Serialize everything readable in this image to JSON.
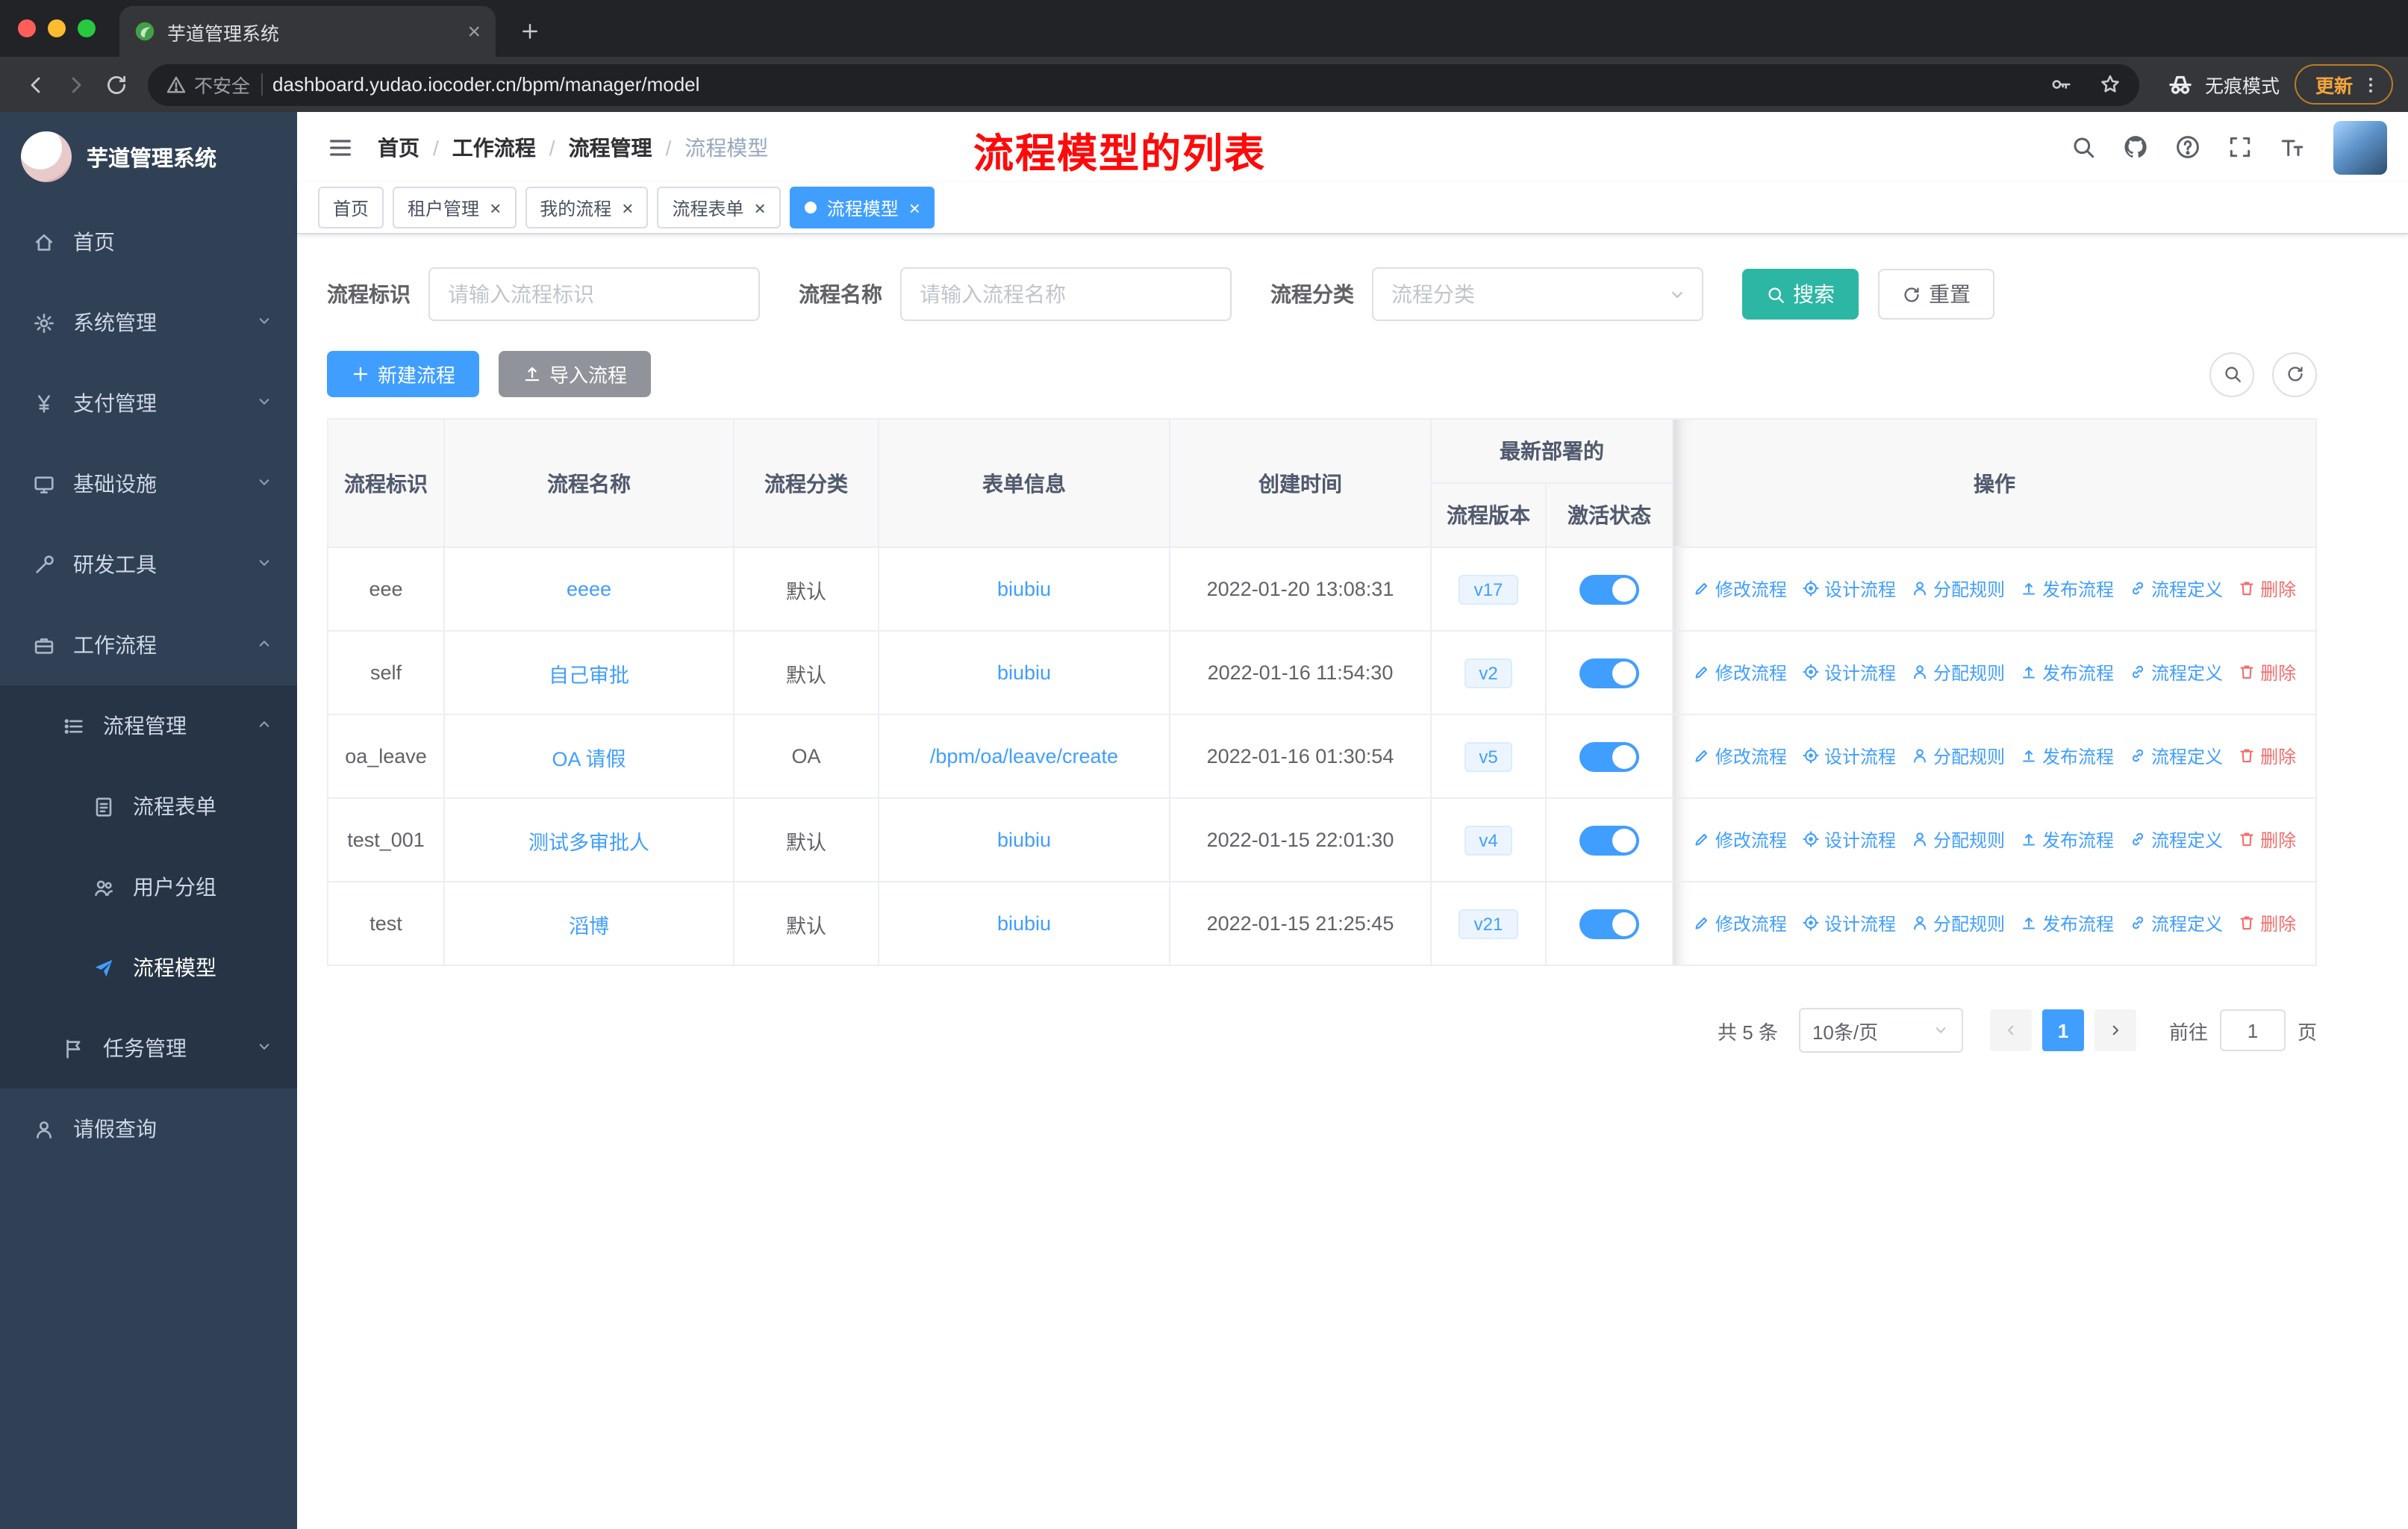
{
  "colors": {
    "primary": "#409eff",
    "search_button": "#2bb7a3",
    "danger": "#f56c6c",
    "annotation": "#fd0b0b",
    "sidebar_bg": "#304156",
    "sidebar_submenu_bg": "#263445",
    "update_pill": "#f1a33c"
  },
  "browser": {
    "tab_title": "芋道管理系统",
    "security_label": "不安全",
    "url": "dashboard.yudao.iocoder.cn/bpm/manager/model",
    "incognito_label": "无痕模式",
    "update_label": "更新"
  },
  "sidebar": {
    "logo_title": "芋道管理系统",
    "items": [
      {
        "id": "home",
        "label": "首页",
        "icon": "home-icon",
        "depth": 0
      },
      {
        "id": "system",
        "label": "系统管理",
        "icon": "gear-icon",
        "depth": 0,
        "arrow": "down"
      },
      {
        "id": "payment",
        "label": "支付管理",
        "icon": "yen-icon",
        "depth": 0,
        "arrow": "down"
      },
      {
        "id": "infra",
        "label": "基础设施",
        "icon": "monitor-icon",
        "depth": 0,
        "arrow": "down"
      },
      {
        "id": "devtools",
        "label": "研发工具",
        "icon": "wrench-icon",
        "depth": 0,
        "arrow": "down"
      },
      {
        "id": "workflow",
        "label": "工作流程",
        "icon": "briefcase-icon",
        "depth": 0,
        "arrow": "up"
      },
      {
        "id": "process-mgmt",
        "label": "流程管理",
        "icon": "list-icon",
        "depth": 1,
        "arrow": "up",
        "sub": true
      },
      {
        "id": "process-form",
        "label": "流程表单",
        "icon": "document-icon",
        "depth": 2,
        "sub": true
      },
      {
        "id": "user-group",
        "label": "用户分组",
        "icon": "users-icon",
        "depth": 2,
        "sub": true
      },
      {
        "id": "process-model",
        "label": "流程模型",
        "icon": "send-icon",
        "depth": 2,
        "sub": true,
        "active": true
      },
      {
        "id": "task-mgmt",
        "label": "任务管理",
        "icon": "flag-icon",
        "depth": 1,
        "arrow": "down",
        "sub": true
      },
      {
        "id": "leave-query",
        "label": "请假查询",
        "icon": "user-icon",
        "depth": 0
      }
    ]
  },
  "header": {
    "breadcrumb": [
      "首页",
      "工作流程",
      "流程管理",
      "流程模型"
    ],
    "annotation": "流程模型的列表"
  },
  "tabs": [
    {
      "id": "home",
      "label": "首页",
      "closable": false,
      "active": false
    },
    {
      "id": "tenant",
      "label": "租户管理",
      "closable": true,
      "active": false
    },
    {
      "id": "my-process",
      "label": "我的流程",
      "closable": true,
      "active": false
    },
    {
      "id": "process-form",
      "label": "流程表单",
      "closable": true,
      "active": false
    },
    {
      "id": "process-model",
      "label": "流程模型",
      "closable": true,
      "active": true
    }
  ],
  "filters": {
    "key_label": "流程标识",
    "key_placeholder": "请输入流程标识",
    "name_label": "流程名称",
    "name_placeholder": "请输入流程名称",
    "category_label": "流程分类",
    "category_placeholder": "流程分类",
    "search_button": "搜索",
    "reset_button": "重置"
  },
  "toolbar": {
    "create_button": "新建流程",
    "import_button": "导入流程"
  },
  "table": {
    "headers": {
      "key": "流程标识",
      "name": "流程名称",
      "category": "流程分类",
      "form": "表单信息",
      "created": "创建时间",
      "deploy_group": "最新部署的",
      "version": "流程版本",
      "status": "激活状态",
      "actions": "操作"
    },
    "actions": [
      {
        "id": "edit",
        "label": "修改流程",
        "icon": "edit-icon"
      },
      {
        "id": "design",
        "label": "设计流程",
        "icon": "target-icon"
      },
      {
        "id": "assign",
        "label": "分配规则",
        "icon": "user-icon"
      },
      {
        "id": "publish",
        "label": "发布流程",
        "icon": "publish-icon"
      },
      {
        "id": "definition",
        "label": "流程定义",
        "icon": "link-icon"
      },
      {
        "id": "delete",
        "label": "删除",
        "icon": "trash-icon",
        "danger": true
      }
    ],
    "rows": [
      {
        "key": "eee",
        "name": "eeee",
        "category": "默认",
        "form": "biubiu",
        "created": "2022-01-20 13:08:31",
        "version": "v17",
        "active": true
      },
      {
        "key": "self",
        "name": "自己审批",
        "category": "默认",
        "form": "biubiu",
        "created": "2022-01-16 11:54:30",
        "version": "v2",
        "active": true
      },
      {
        "key": "oa_leave",
        "name": "OA 请假",
        "category": "OA",
        "form": "/bpm/oa/leave/create",
        "created": "2022-01-16 01:30:54",
        "version": "v5",
        "active": true
      },
      {
        "key": "test_001",
        "name": "测试多审批人",
        "category": "默认",
        "form": "biubiu",
        "created": "2022-01-15 22:01:30",
        "version": "v4",
        "active": true
      },
      {
        "key": "test",
        "name": "滔博",
        "category": "默认",
        "form": "biubiu",
        "created": "2022-01-15 21:25:45",
        "version": "v21",
        "active": true
      }
    ]
  },
  "pagination": {
    "total": "共 5 条",
    "page_size": "10条/页",
    "current_page": "1",
    "goto_label": "前往",
    "goto_value": "1",
    "page_label": "页"
  }
}
